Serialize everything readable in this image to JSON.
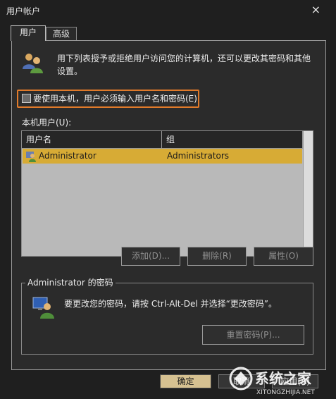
{
  "window": {
    "title": "用户帐户",
    "close_glyph": "×"
  },
  "tabs": [
    {
      "label": "用户"
    },
    {
      "label": "高级"
    }
  ],
  "users_tab": {
    "intro_text": "用下列表授予或拒绝用户访问您的计算机，还可以更改其密码和其他设置。",
    "require_login_checkbox": {
      "label": "要使用本机，用户必须输入用户名和密码(E)",
      "checked": false
    },
    "local_users_label": "本机用户(U):",
    "table": {
      "columns": [
        "用户名",
        "组"
      ],
      "rows": [
        {
          "name": "Administrator",
          "group": "Administrators",
          "selected": true
        }
      ]
    },
    "buttons": {
      "add": "添加(D)...",
      "remove": "删除(R)",
      "properties": "属性(O)"
    },
    "password_group": {
      "title": "Administrator 的密码",
      "text": "要更改您的密码，请按 Ctrl-Alt-Del 并选择“更改密码”。",
      "reset_button": "重置密码(P)..."
    }
  },
  "footer_buttons": {
    "ok": "确定",
    "cancel": "取消",
    "apply": "应用(A)"
  },
  "watermark": {
    "brand": "系统之家",
    "url": "XITONGZHIJIA.NET"
  },
  "colors": {
    "accent_highlight": "#e07a2a",
    "selection": "#d7ab35",
    "background": "#2b2b2b"
  }
}
